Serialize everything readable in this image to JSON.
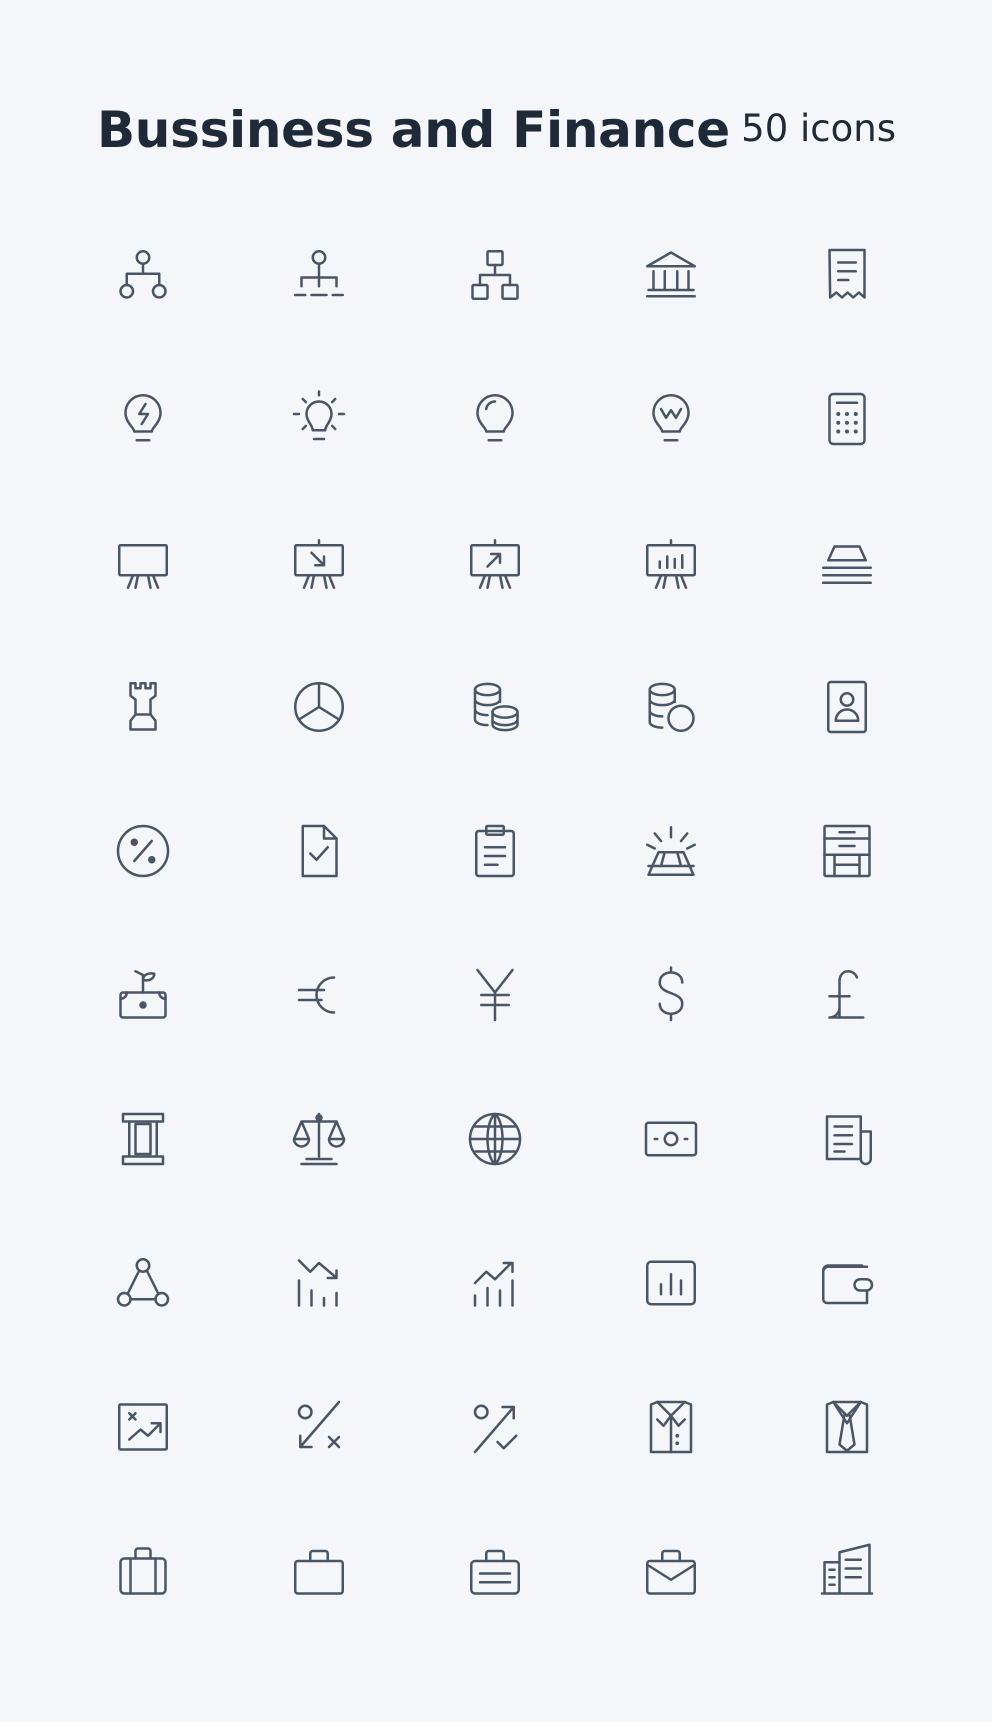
{
  "header": {
    "title": "Bussiness and Finance",
    "count": "50 icons"
  },
  "icon_color": "#4b5563",
  "background_color": "#f4f6f9",
  "icons": [
    "hierarchy-tree-icon",
    "organization-chart-icon",
    "sitemap-icon",
    "bank-icon",
    "receipt-icon",
    "lightbulb-bolt-icon",
    "lightbulb-idea-icon",
    "lightbulb-icon",
    "lightbulb-brand-icon",
    "calculator-icon",
    "presentation-board-icon",
    "presentation-arrow-down-icon",
    "presentation-arrow-up-icon",
    "presentation-chart-icon",
    "gold-bars-stack-icon",
    "chess-rook-icon",
    "pie-chart-icon",
    "coin-stack-icon",
    "coins-icon",
    "contact-card-icon",
    "percent-circle-icon",
    "document-check-icon",
    "clipboard-icon",
    "gold-bar-shine-icon",
    "drawer-cabinet-icon",
    "money-plant-icon",
    "euro-icon",
    "yen-icon",
    "dollar-icon",
    "pound-icon",
    "scroll-icon",
    "scale-balance-icon",
    "globe-icon",
    "banknote-icon",
    "newspaper-icon",
    "network-nodes-icon",
    "trend-down-chart-icon",
    "trend-up-chart-icon",
    "bar-chart-box-icon",
    "wallet-icon",
    "chart-whiteboard-icon",
    "percent-down-x-icon",
    "percent-up-check-icon",
    "shirt-collar-icon",
    "shirt-tie-icon",
    "suitcase-icon",
    "briefcase-icon",
    "briefcase-lines-icon",
    "briefcase-envelope-icon",
    "office-building-icon"
  ]
}
